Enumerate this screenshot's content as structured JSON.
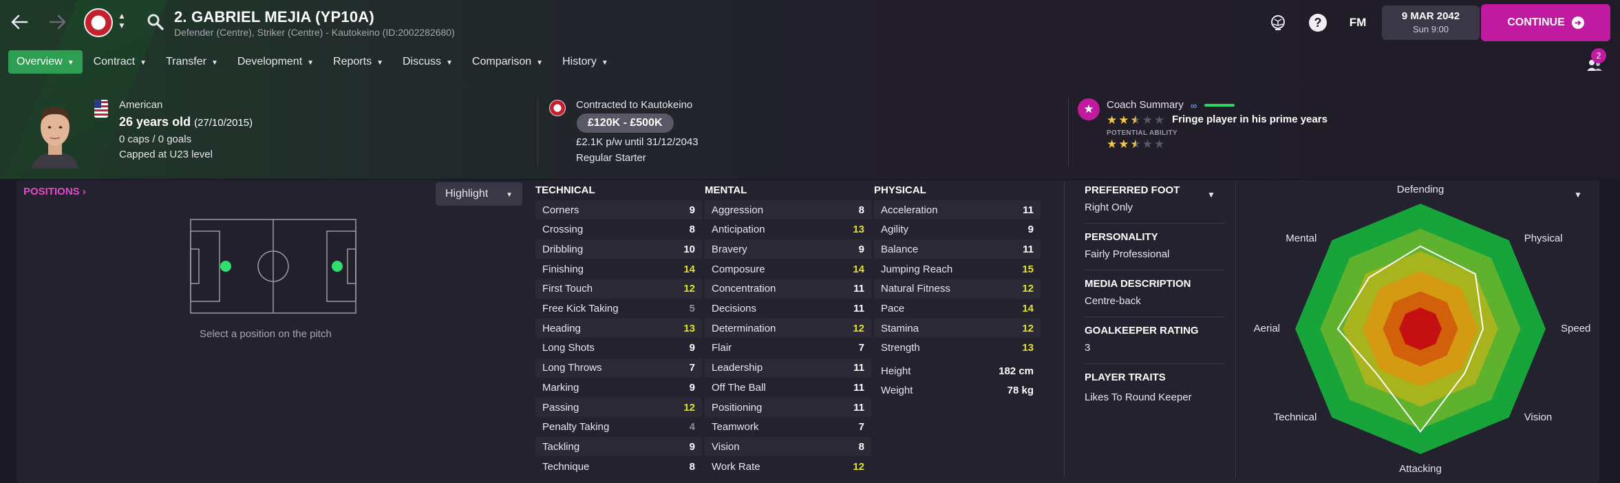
{
  "header": {
    "player_title": "2. GABRIEL MEJIA (YP10A)",
    "player_subtitle": "Defender (Centre), Striker (Centre) - Kautokeino (ID:2002282680)",
    "date": "9 MAR 2042",
    "time": "Sun 9:00",
    "continue_label": "CONTINUE",
    "fm_label": "FM",
    "help_label": "?"
  },
  "tabs": [
    {
      "label": "Overview",
      "active": true
    },
    {
      "label": "Contract"
    },
    {
      "label": "Transfer"
    },
    {
      "label": "Development"
    },
    {
      "label": "Reports"
    },
    {
      "label": "Discuss"
    },
    {
      "label": "Comparison"
    },
    {
      "label": "History"
    }
  ],
  "notifications": {
    "count": "2"
  },
  "profile": {
    "nationality": "American",
    "age": "26 years old",
    "dob": "(27/10/2015)",
    "caps": "0 caps / 0 goals",
    "capped_level": "Capped at U23 level"
  },
  "contract": {
    "title": "Contracted to Kautokeino",
    "value": "£120K - £500K",
    "wage": "£2.1K p/w until 31/12/2043",
    "squad_status": "Regular Starter"
  },
  "coach": {
    "title": "Coach Summary",
    "current_ability_stars": 2.5,
    "current_ability_text": "Fringe player in his prime years",
    "potential_label": "POTENTIAL ABILITY",
    "potential_ability_stars": 2.5
  },
  "positions": {
    "link": "POSITIONS",
    "highlight_label": "Highlight",
    "hint": "Select a position on the pitch"
  },
  "attributes": {
    "technical_title": "TECHNICAL",
    "mental_title": "MENTAL",
    "physical_title": "PHYSICAL",
    "technical": [
      {
        "name": "Corners",
        "value": 9
      },
      {
        "name": "Crossing",
        "value": 8
      },
      {
        "name": "Dribbling",
        "value": 10
      },
      {
        "name": "Finishing",
        "value": 14
      },
      {
        "name": "First Touch",
        "value": 12
      },
      {
        "name": "Free Kick Taking",
        "value": 5
      },
      {
        "name": "Heading",
        "value": 13
      },
      {
        "name": "Long Shots",
        "value": 9
      },
      {
        "name": "Long Throws",
        "value": 7
      },
      {
        "name": "Marking",
        "value": 9
      },
      {
        "name": "Passing",
        "value": 12
      },
      {
        "name": "Penalty Taking",
        "value": 4
      },
      {
        "name": "Tackling",
        "value": 9
      },
      {
        "name": "Technique",
        "value": 8
      }
    ],
    "mental": [
      {
        "name": "Aggression",
        "value": 8
      },
      {
        "name": "Anticipation",
        "value": 13
      },
      {
        "name": "Bravery",
        "value": 9
      },
      {
        "name": "Composure",
        "value": 14
      },
      {
        "name": "Concentration",
        "value": 11
      },
      {
        "name": "Decisions",
        "value": 11
      },
      {
        "name": "Determination",
        "value": 12
      },
      {
        "name": "Flair",
        "value": 7
      },
      {
        "name": "Leadership",
        "value": 11
      },
      {
        "name": "Off The Ball",
        "value": 11
      },
      {
        "name": "Positioning",
        "value": 11
      },
      {
        "name": "Teamwork",
        "value": 7
      },
      {
        "name": "Vision",
        "value": 8
      },
      {
        "name": "Work Rate",
        "value": 12
      }
    ],
    "physical": [
      {
        "name": "Acceleration",
        "value": 11
      },
      {
        "name": "Agility",
        "value": 9
      },
      {
        "name": "Balance",
        "value": 11
      },
      {
        "name": "Jumping Reach",
        "value": 15
      },
      {
        "name": "Natural Fitness",
        "value": 12
      },
      {
        "name": "Pace",
        "value": 14
      },
      {
        "name": "Stamina",
        "value": 12
      },
      {
        "name": "Strength",
        "value": 13
      }
    ],
    "height_label": "Height",
    "height": "182 cm",
    "weight_label": "Weight",
    "weight": "78 kg"
  },
  "details": {
    "preferred_foot_label": "PREFERRED FOOT",
    "preferred_foot": "Right Only",
    "personality_label": "PERSONALITY",
    "personality": "Fairly Professional",
    "media_label": "MEDIA DESCRIPTION",
    "media": "Centre-back",
    "gk_rating_label": "GOALKEEPER RATING",
    "gk_rating": "3",
    "traits_label": "PLAYER TRAITS",
    "traits": "Likes To Round Keeper"
  },
  "radar": {
    "labels": [
      "Defending",
      "Physical",
      "Speed",
      "Vision",
      "Attacking",
      "Technical",
      "Aerial",
      "Mental"
    ],
    "values": [
      0.66,
      0.62,
      0.5,
      0.5,
      0.82,
      0.5,
      0.66,
      0.58
    ]
  },
  "colors": {
    "accent": "#c01ba0",
    "tab_active": "#2f9d52",
    "highlight_value": "#e3e12c"
  }
}
